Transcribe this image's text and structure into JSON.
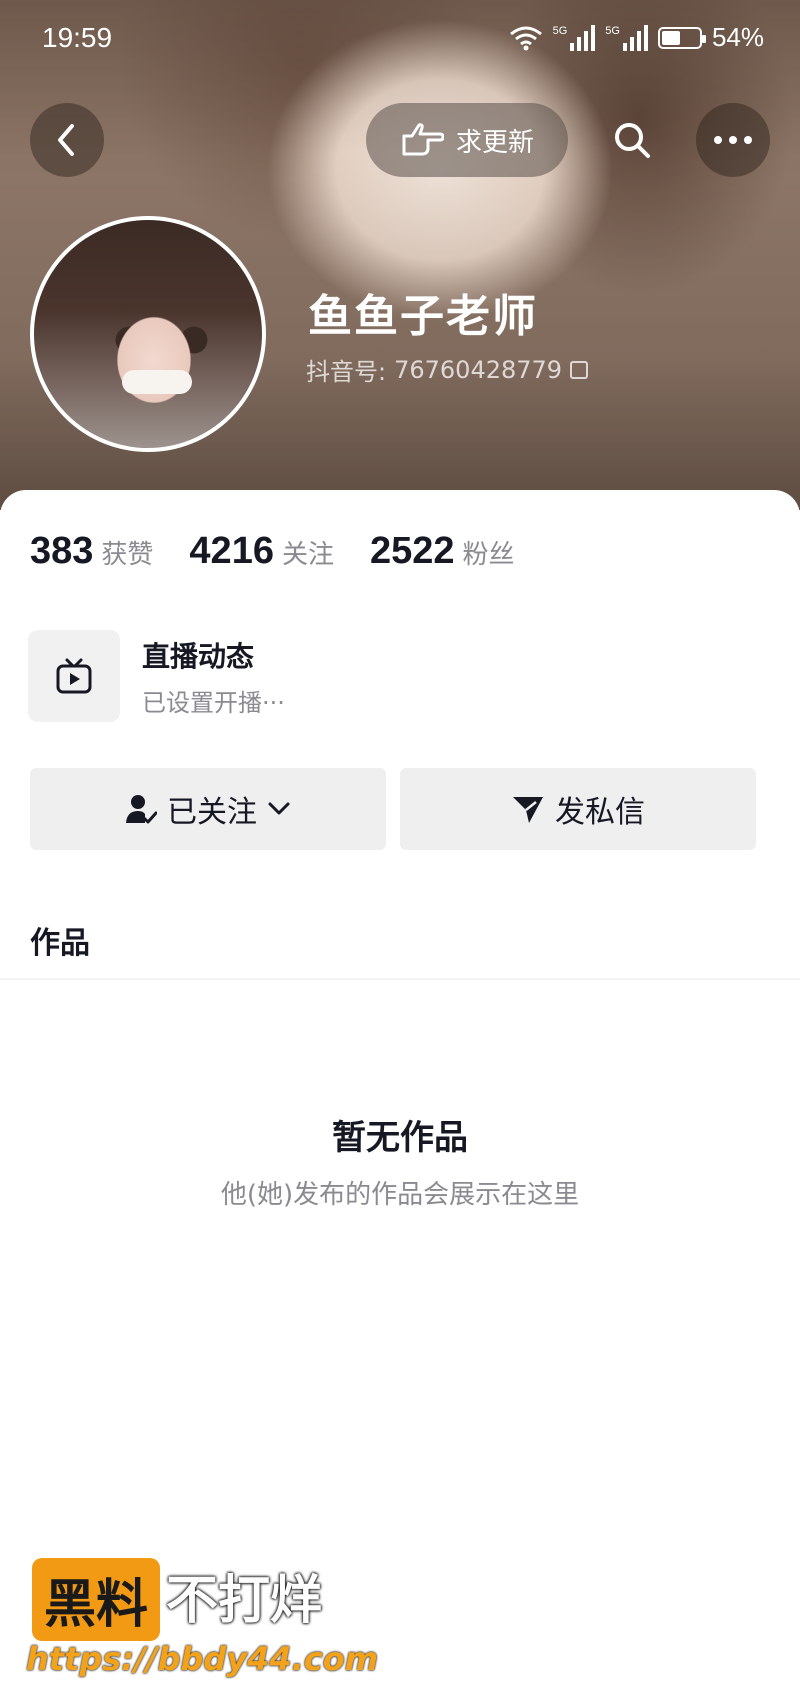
{
  "status_bar": {
    "time": "19:59",
    "network": [
      "5G",
      "5G"
    ],
    "battery": "54%"
  },
  "header": {
    "request_update_label": "求更新"
  },
  "profile": {
    "name": "鱼鱼子老师",
    "id_label": "抖音号:",
    "id_value": "76760428779"
  },
  "stats": [
    {
      "value": "383",
      "label": "获赞"
    },
    {
      "value": "4216",
      "label": "关注"
    },
    {
      "value": "2522",
      "label": "粉丝"
    }
  ],
  "live": {
    "title": "直播动态",
    "subtitle": "已设置开播···"
  },
  "actions": {
    "follow_label": "已关注",
    "message_label": "发私信"
  },
  "tabs": {
    "works": "作品"
  },
  "empty": {
    "title": "暂无作品",
    "subtitle": "他(她)发布的作品会展示在这里"
  },
  "watermark": {
    "badge": "黑料",
    "text": "不打烊",
    "url": "https://bbdy44.com"
  },
  "colors": {
    "accent": "#f39a15",
    "text_primary": "#161823",
    "text_secondary": "#8a8b91",
    "button_bg": "#efeff0"
  }
}
